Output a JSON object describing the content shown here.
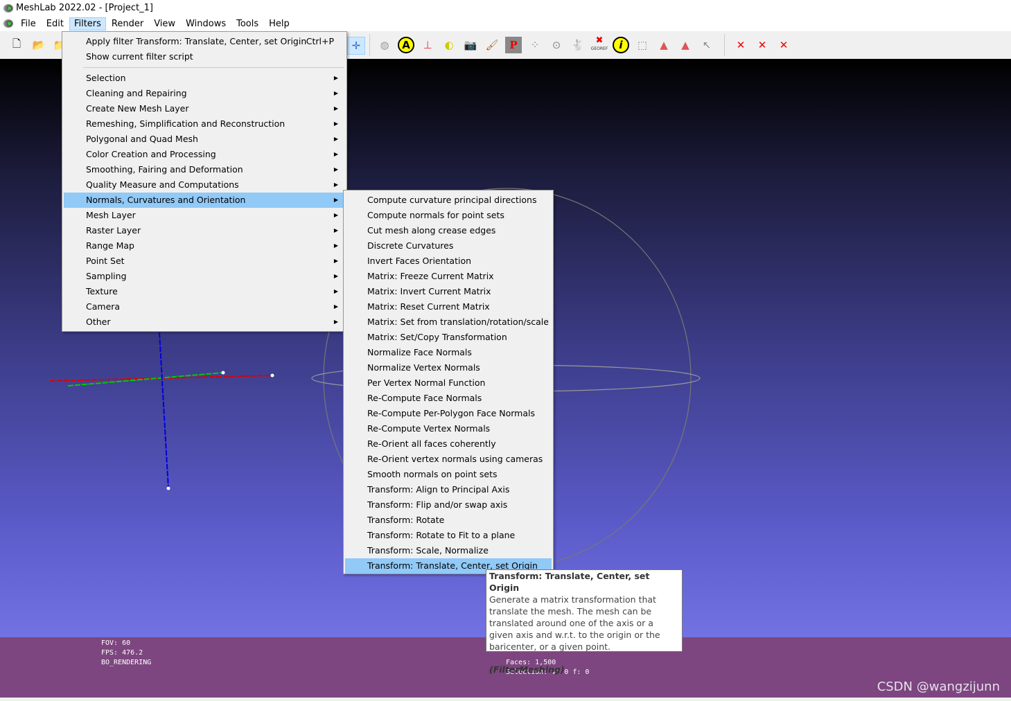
{
  "window": {
    "title": "MeshLab 2022.02 - [Project_1]"
  },
  "menubar": [
    "File",
    "Edit",
    "Filters",
    "Render",
    "View",
    "Windows",
    "Tools",
    "Help"
  ],
  "filters_menu": {
    "top": [
      {
        "label": "Apply filter Transform: Translate, Center, set Origin",
        "shortcut": "Ctrl+P"
      },
      {
        "label": "Show current filter script"
      }
    ],
    "items": [
      "Selection",
      "Cleaning and Repairing",
      "Create New Mesh Layer",
      "Remeshing, Simplification and Reconstruction",
      "Polygonal and Quad Mesh",
      "Color Creation and Processing",
      "Smoothing, Fairing and Deformation",
      "Quality Measure and Computations",
      "Normals, Curvatures and Orientation",
      "Mesh Layer",
      "Raster Layer",
      "Range Map",
      "Point Set",
      "Sampling",
      "Texture",
      "Camera",
      "Other"
    ],
    "highlighted": "Normals, Curvatures and Orientation"
  },
  "submenu": {
    "items": [
      "Compute curvature principal directions",
      "Compute normals for point sets",
      "Cut mesh along crease edges",
      "Discrete Curvatures",
      "Invert Faces Orientation",
      "Matrix: Freeze Current Matrix",
      "Matrix: Invert Current Matrix",
      "Matrix: Reset Current Matrix",
      "Matrix: Set from translation/rotation/scale",
      "Matrix: Set/Copy Transformation",
      "Normalize Face Normals",
      "Normalize Vertex Normals",
      "Per Vertex Normal Function",
      "Re-Compute Face Normals",
      "Re-Compute Per-Polygon Face Normals",
      "Re-Compute Vertex Normals",
      "Re-Orient all faces coherently",
      "Re-Orient vertex normals using cameras",
      "Smooth normals on point sets",
      "Transform: Align to Principal Axis",
      "Transform: Flip and/or swap axis",
      "Transform: Rotate",
      "Transform: Rotate to Fit to a plane",
      "Transform: Scale, Normalize",
      "Transform: Translate, Center, set Origin"
    ],
    "highlighted": "Transform: Translate, Center, set Origin"
  },
  "tooltip": {
    "title": "Transform: Translate, Center, set Origin",
    "body": "Generate a matrix transformation that translate the mesh. The mesh can be translated around one of the axis or a given axis and w.r.t. to the origin or the baricenter, or a given point.",
    "plugin": "(FilterMeshing)"
  },
  "info_left": [
    "FOV: 60",
    "FPS:   476.2",
    "BO_RENDERING"
  ],
  "info_right": [
    "Faces: 1,500",
    "Selection: v: 0 f: 0"
  ],
  "toolbar_text": {
    "georef": "GEOREF"
  },
  "watermark": "CSDN @wangzijunn",
  "colors": {
    "menu_highlight": "#91c9f7",
    "bottom_bar": "#7d4680",
    "viewport_bottom": "#7272e4"
  }
}
